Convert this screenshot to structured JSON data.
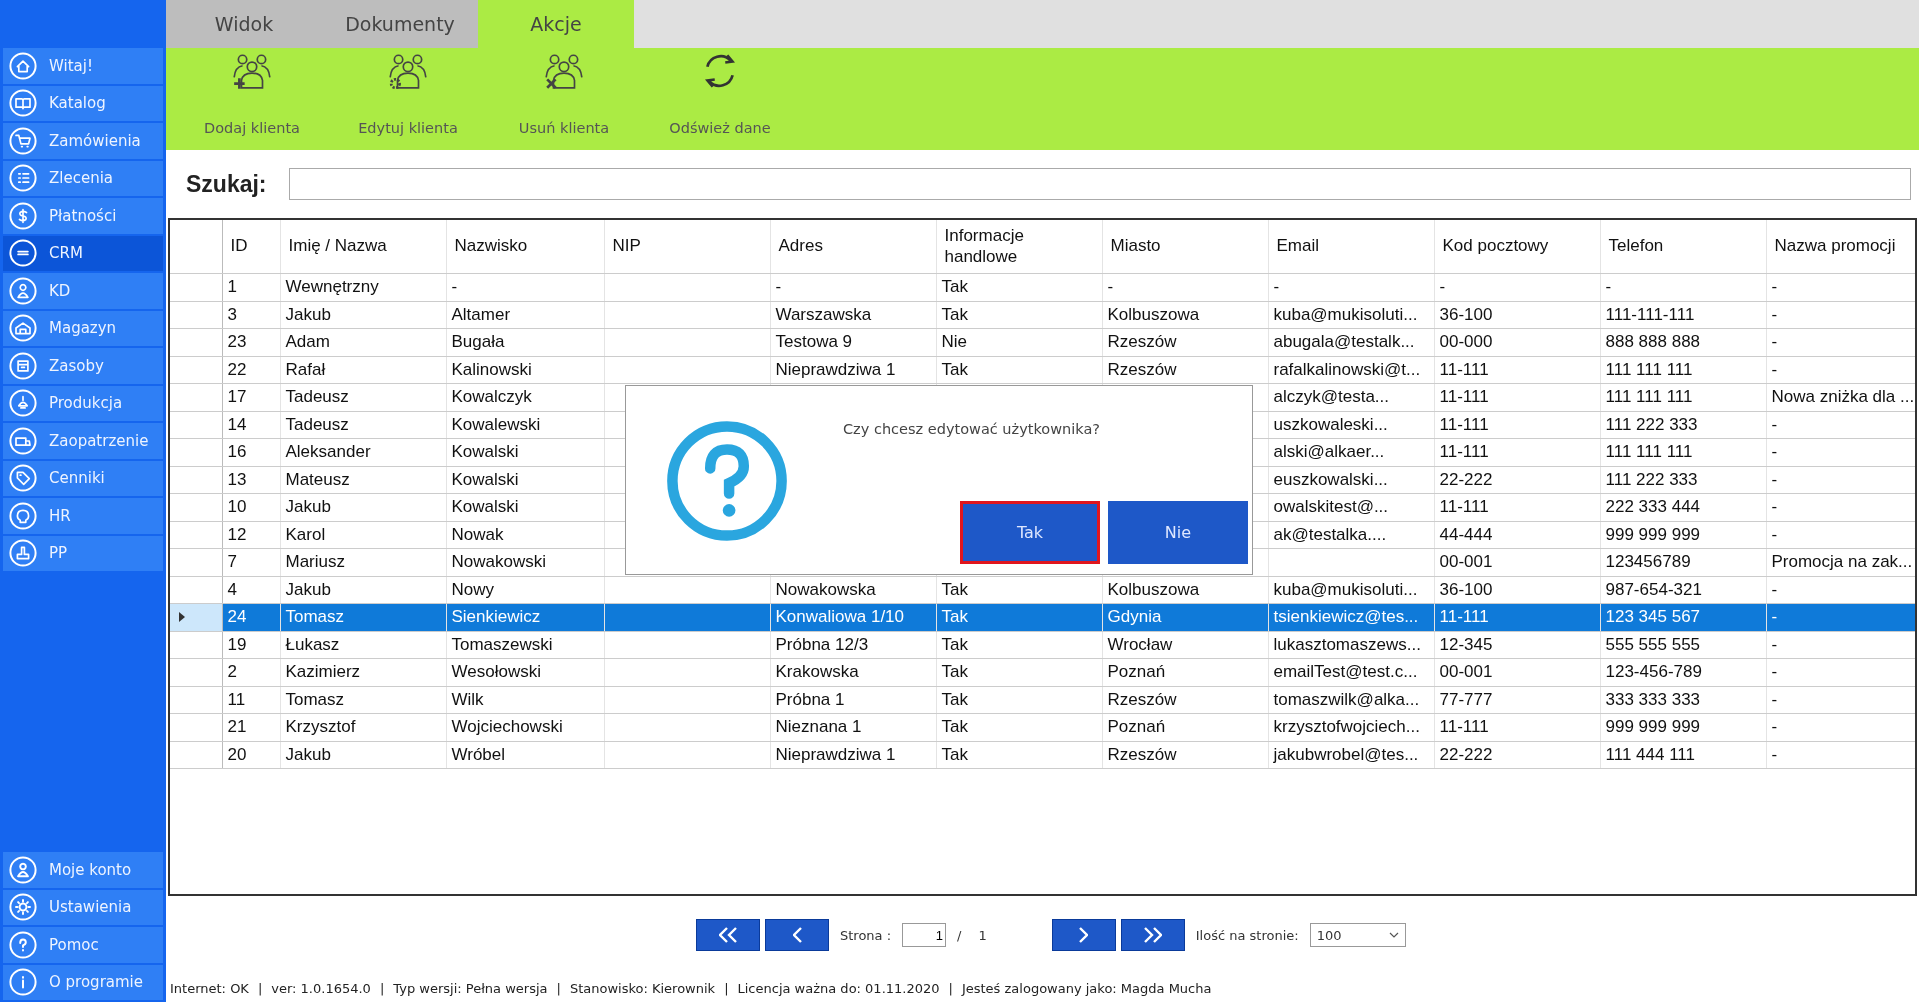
{
  "sidebar": {
    "items": [
      {
        "label": "Witaj!",
        "selected": false
      },
      {
        "label": "Katalog",
        "selected": false
      },
      {
        "label": "Zamówienia",
        "selected": false
      },
      {
        "label": "Zlecenia",
        "selected": false
      },
      {
        "label": "Płatności",
        "selected": false
      },
      {
        "label": "CRM",
        "selected": true
      },
      {
        "label": "KD",
        "selected": false
      },
      {
        "label": "Magazyn",
        "selected": false
      },
      {
        "label": "Zasoby",
        "selected": false
      },
      {
        "label": "Produkcja",
        "selected": false
      },
      {
        "label": "Zaopatrzenie",
        "selected": false
      },
      {
        "label": "Cenniki",
        "selected": false
      },
      {
        "label": "HR",
        "selected": false
      },
      {
        "label": "PP",
        "selected": false
      }
    ],
    "bottom_items": [
      {
        "label": "Moje konto"
      },
      {
        "label": "Ustawienia"
      },
      {
        "label": "Pomoc"
      },
      {
        "label": "O programie"
      }
    ]
  },
  "tabs": [
    {
      "label": "Widok",
      "selected": false
    },
    {
      "label": "Dokumenty",
      "selected": false
    },
    {
      "label": "Akcje",
      "selected": true
    }
  ],
  "toolbar": [
    {
      "label": "Dodaj klienta"
    },
    {
      "label": "Edytuj klienta"
    },
    {
      "label": "Usuń klienta"
    },
    {
      "label": "Odśwież dane"
    }
  ],
  "search": {
    "label": "Szukaj:"
  },
  "table": {
    "columns": [
      "ID",
      "Imię / Nazwa",
      "Nazwisko",
      "NIP",
      "Adres",
      "Informacje handlowe",
      "Miasto",
      "Email",
      "Kod pocztowy",
      "Telefon",
      "Nazwa promocji"
    ],
    "rows": [
      {
        "selected": false,
        "cells": [
          "1",
          "Wewnętrzny",
          "-",
          null,
          "-",
          "Tak",
          "-",
          "-",
          "-",
          "-",
          "-"
        ]
      },
      {
        "selected": false,
        "cells": [
          "3",
          "Jakub",
          "Altamer",
          null,
          "Warszawska",
          "Tak",
          "Kolbuszowa",
          "kuba@mukisoluti...",
          "36-100",
          "111-111-111",
          "-"
        ]
      },
      {
        "selected": false,
        "cells": [
          "23",
          "Adam",
          "Bugała",
          null,
          "Testowa 9",
          "Nie",
          "Rzeszów",
          "abugala@testalk...",
          "00-000",
          "888 888 888",
          "-"
        ]
      },
      {
        "selected": false,
        "cells": [
          "22",
          "Rafał",
          "Kalinowski",
          null,
          "Nieprawdziwa 1",
          "Tak",
          "Rzeszów",
          "rafalkalinowski@t...",
          "11-111",
          "111 111 111",
          "-"
        ]
      },
      {
        "selected": false,
        "cells": [
          "17",
          "Tadeusz",
          "Kowalczyk",
          null,
          null,
          null,
          null,
          "alczyk@testa...",
          "11-111",
          "111 111 111",
          "Nowa zniżka dla ..."
        ]
      },
      {
        "selected": false,
        "cells": [
          "14",
          "Tadeusz",
          "Kowalewski",
          null,
          null,
          null,
          null,
          "uszkowaleski...",
          "11-111",
          "111 222 333",
          "-"
        ]
      },
      {
        "selected": false,
        "cells": [
          "16",
          "Aleksander",
          "Kowalski",
          null,
          null,
          null,
          null,
          "alski@alkaer...",
          "11-111",
          "111 111 111",
          "-"
        ]
      },
      {
        "selected": false,
        "cells": [
          "13",
          "Mateusz",
          "Kowalski",
          null,
          null,
          null,
          null,
          "euszkowalski...",
          "22-222",
          "111 222 333",
          "-"
        ]
      },
      {
        "selected": false,
        "cells": [
          "10",
          "Jakub",
          "Kowalski",
          null,
          null,
          null,
          null,
          "owalskitest@...",
          "11-111",
          "222 333 444",
          "-"
        ]
      },
      {
        "selected": false,
        "cells": [
          "12",
          "Karol",
          "Nowak",
          null,
          null,
          null,
          null,
          "ak@testalka....",
          "44-444",
          "999 999 999",
          "-"
        ]
      },
      {
        "selected": false,
        "cells": [
          "7",
          "Mariusz",
          "Nowakowski",
          null,
          null,
          null,
          null,
          null,
          "00-001",
          "123456789",
          "Promocja na zak..."
        ]
      },
      {
        "selected": false,
        "cells": [
          "4",
          "Jakub",
          "Nowy",
          null,
          "Nowakowska",
          "Tak",
          "Kolbuszowa",
          "kuba@mukisoluti...",
          "36-100",
          "987-654-321",
          "-"
        ]
      },
      {
        "selected": true,
        "cells": [
          "24",
          "Tomasz",
          "Sienkiewicz",
          null,
          "Konwaliowa 1/10",
          "Tak",
          "Gdynia",
          "tsienkiewicz@tes...",
          "11-111",
          "123 345 567",
          "-"
        ]
      },
      {
        "selected": false,
        "cells": [
          "19",
          "Łukasz",
          "Tomaszewski",
          null,
          "Próbna 12/3",
          "Tak",
          "Wrocław",
          "lukasztomaszews...",
          "12-345",
          "555 555 555",
          "-"
        ]
      },
      {
        "selected": false,
        "cells": [
          "2",
          "Kazimierz",
          "Wesołowski",
          null,
          "Krakowska",
          "Tak",
          "Poznań",
          "emailTest@test.c...",
          "00-001",
          "123-456-789",
          "-"
        ]
      },
      {
        "selected": false,
        "cells": [
          "11",
          "Tomasz",
          "Wilk",
          null,
          "Próbna 1",
          "Tak",
          "Rzeszów",
          "tomaszwilk@alka...",
          "77-777",
          "333 333 333",
          "-"
        ]
      },
      {
        "selected": false,
        "cells": [
          "21",
          "Krzysztof",
          "Wojciechowski",
          null,
          "Nieznana 1",
          "Tak",
          "Poznań",
          "krzysztofwojciech...",
          "11-111",
          "999 999 999",
          "-"
        ]
      },
      {
        "selected": false,
        "cells": [
          "20",
          "Jakub",
          "Wróbel",
          null,
          "Nieprawdziwa 1",
          "Tak",
          "Rzeszów",
          "jakubwrobel@tes...",
          "22-222",
          "111 444 111",
          "-"
        ]
      }
    ]
  },
  "dialog": {
    "message": "Czy chcesz edytować użytkownika?",
    "buttons": [
      {
        "label": "Tak",
        "focused": true
      },
      {
        "label": "Nie",
        "focused": false
      }
    ]
  },
  "pagination": {
    "page_label": "Strona :",
    "page": "1",
    "separator": "/",
    "total": "1",
    "per_page_label": "Ilość na stronie:",
    "per_page": "100"
  },
  "status_bar": {
    "separator": "|",
    "items": [
      "Internet: OK",
      "ver: 1.0.1654.0",
      "Typ wersji: Pełna wersja",
      "Stanowisko: Kierownik",
      "Licencja ważna do: 01.11.2020",
      "Jesteś zalogowany jako: Magda Mucha"
    ]
  }
}
